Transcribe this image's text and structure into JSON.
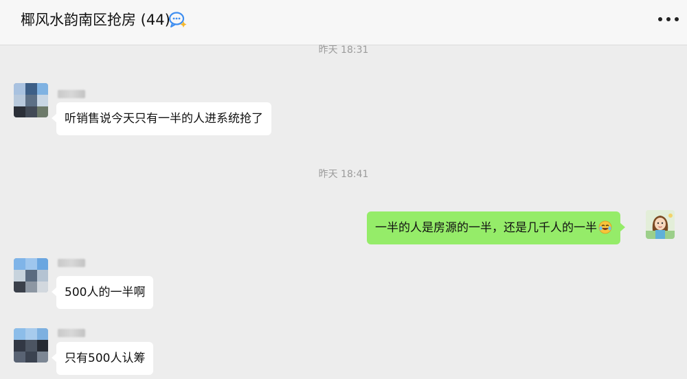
{
  "header": {
    "title": "椰风水韵南区抢房 (44)",
    "title_icon": "chat-bubble-icon",
    "more_icon": "more-icon"
  },
  "messages": [
    {
      "type": "timestamp",
      "text": "昨天 18:31"
    },
    {
      "type": "incoming",
      "text": "听销售说今天只有一半的人进系统抢了"
    },
    {
      "type": "timestamp",
      "text": "昨天 18:41"
    },
    {
      "type": "outgoing",
      "text": "一半的人是房源的一半，还是几千人的一半",
      "emoji": "laughing-crying-emoji-icon"
    },
    {
      "type": "incoming",
      "text": "500人的一半啊"
    },
    {
      "type": "incoming",
      "text": "只有500人认筹"
    }
  ],
  "colors": {
    "background": "#ededed",
    "header_bg": "#f7f7f7",
    "outgoing_bubble": "#95ec69",
    "incoming_bubble": "#ffffff",
    "timestamp_text": "#9b9b9b"
  }
}
